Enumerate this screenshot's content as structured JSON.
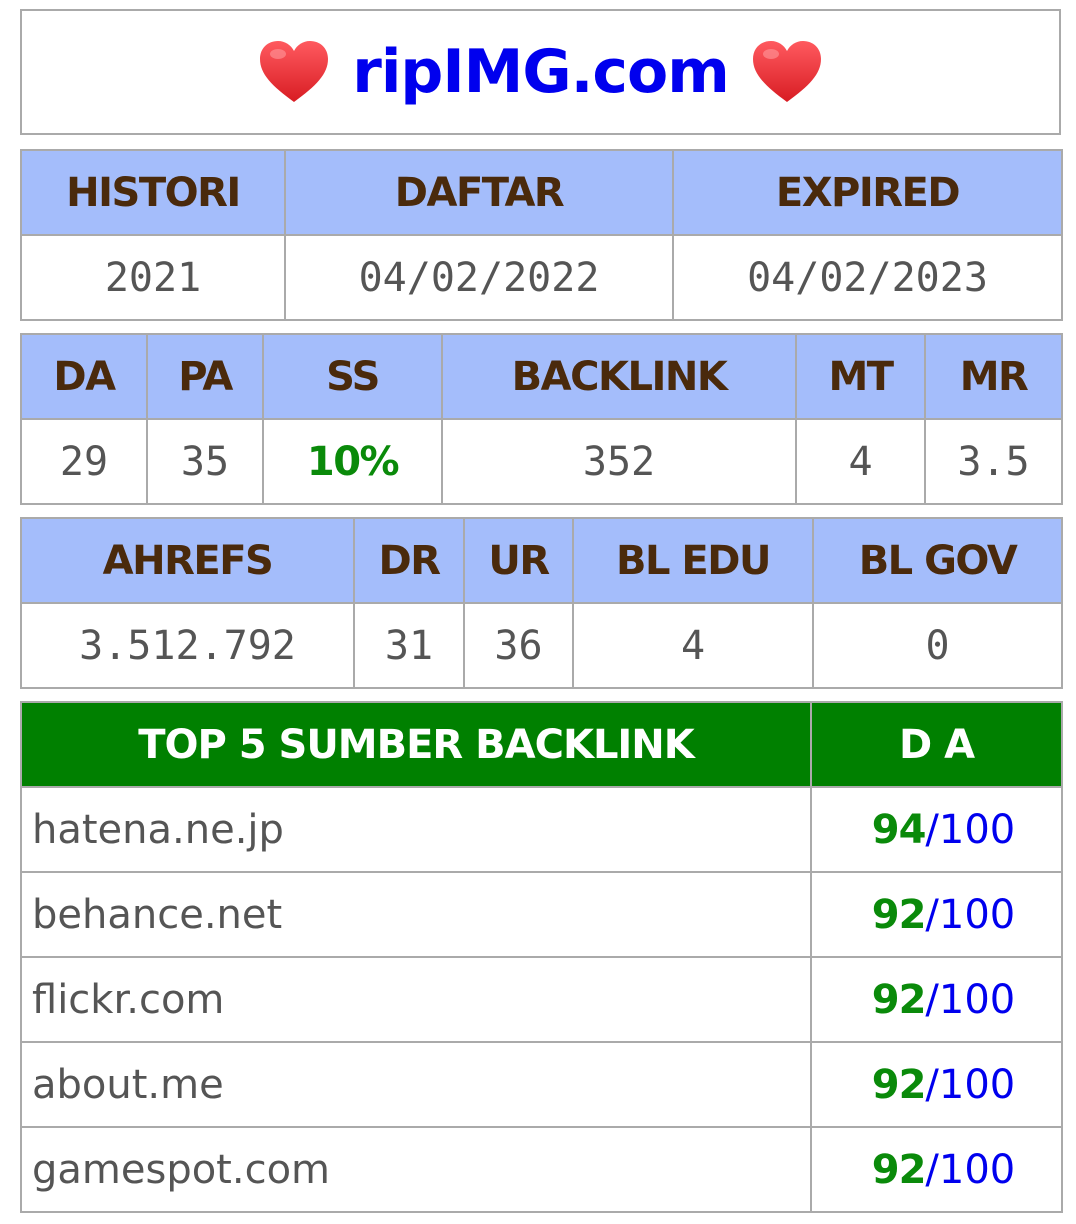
{
  "header": {
    "title": "ripIMG.com",
    "heart_icon": "heart-icon",
    "heart_color": "#e8242b",
    "title_color": "#0000ee"
  },
  "history": {
    "headers": [
      "HISTORI",
      "DAFTAR",
      "EXPIRED"
    ],
    "values": [
      "2021",
      "04/02/2022",
      "04/02/2023"
    ]
  },
  "metrics": {
    "headers": [
      "DA",
      "PA",
      "SS",
      "BACKLINK",
      "MT",
      "MR"
    ],
    "values": [
      "29",
      "35",
      "10%",
      "352",
      "4",
      "3.5"
    ]
  },
  "ahrefs": {
    "headers": [
      "AHREFS",
      "DR",
      "UR",
      "BL EDU",
      "BL GOV"
    ],
    "values": [
      "3.512.792",
      "31",
      "36",
      "4",
      "0"
    ]
  },
  "top_backlinks": {
    "headers": [
      "TOP 5 SUMBER BACKLINK",
      "D A"
    ],
    "rows": [
      {
        "domain": "hatena.ne.jp",
        "da": "94",
        "sep": "/",
        "max": "100"
      },
      {
        "domain": "behance.net",
        "da": "92",
        "sep": "/",
        "max": "100"
      },
      {
        "domain": "flickr.com",
        "da": "92",
        "sep": "/",
        "max": "100"
      },
      {
        "domain": "about.me",
        "da": "92",
        "sep": "/",
        "max": "100"
      },
      {
        "domain": "gamespot.com",
        "da": "92",
        "sep": "/",
        "max": "100"
      }
    ]
  },
  "colors": {
    "header_bg": "#a4bdfb",
    "header_text": "#4a2a0c",
    "top_header_bg": "#008000",
    "green": "#0a8a0a",
    "blue": "#0000ee",
    "border": "#aaaaaa"
  }
}
